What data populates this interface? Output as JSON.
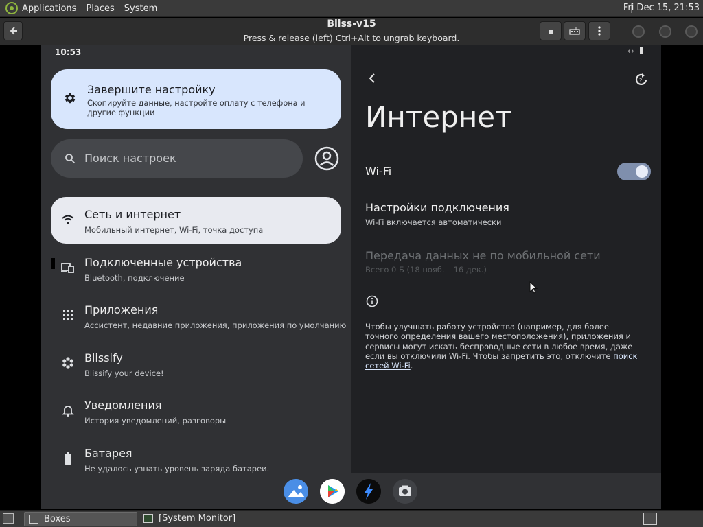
{
  "desktop": {
    "menus": [
      "Applications",
      "Places",
      "System"
    ],
    "clock": "Fri Dec 15, 21:53"
  },
  "header": {
    "title": "Bliss-v15",
    "subtitle": "Press & release (left) Ctrl+Alt to ungrab keyboard."
  },
  "android": {
    "status_time": "10:53",
    "left": {
      "suggestion": {
        "title": "Завершите настройку",
        "text": "Скопируйте данные, настройте оплату с телефона и другие функции"
      },
      "search_placeholder": "Поиск настроек",
      "items": [
        {
          "label": "Сеть и интернет",
          "sub": "Мобильный интернет, Wi-Fi, точка доступа",
          "icon": "wifi-icon"
        },
        {
          "label": "Подключенные устройства",
          "sub": "Bluetooth, подключение",
          "icon": "devices-icon"
        },
        {
          "label": "Приложения",
          "sub": "Ассистент, недавние приложения, приложения по умолчанию",
          "icon": "apps-icon"
        },
        {
          "label": "Blissify",
          "sub": "Blissify your device!",
          "icon": "flower-icon"
        },
        {
          "label": "Уведомления",
          "sub": "История уведомлений, разговоры",
          "icon": "bell-icon"
        },
        {
          "label": "Батарея",
          "sub": "Не удалось узнать уровень заряда батареи.",
          "icon": "battery-icon"
        }
      ]
    },
    "right": {
      "title": "Интернет",
      "wifi_label": "Wi-Fi",
      "wifi_enabled": true,
      "conn_title": "Настройки подключения",
      "conn_sub": "Wi-Fi включается автоматически",
      "data_title": "Передача данных не по мобильной сети",
      "data_sub": "Всего 0 Б (18 нояб. – 16 дек.)",
      "info_text": "Чтобы улучшать работу устройства (например, для более точного определения вашего местоположения), приложения и сервисы могут искать беспроводные сети в любое время, даже если вы отключили Wi-Fi. Чтобы запретить это, отключите",
      "info_link": "поиск сетей Wi-Fi"
    },
    "dock": [
      "gallery-icon",
      "play-store-icon",
      "bolt-icon",
      "camera-icon"
    ]
  },
  "taskbar": {
    "tasks": [
      "Boxes",
      "[System Monitor]"
    ]
  },
  "colors": {
    "accent_card": "#d8e6fd",
    "toggle_on": "#7f8fad",
    "panel_bg": "#3a3a3a"
  }
}
